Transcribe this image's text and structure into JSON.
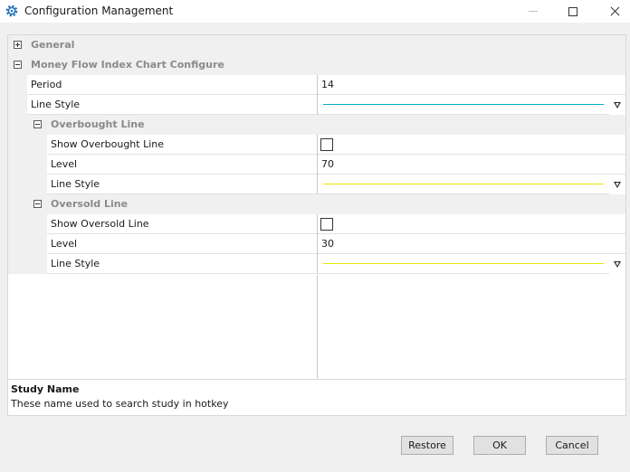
{
  "window": {
    "title": "Configuration Management",
    "icon": "gear-icon"
  },
  "grid": {
    "categories": [
      {
        "label": "General",
        "expanded": false
      },
      {
        "label": "Money Flow Index Chart Configure",
        "expanded": true
      }
    ],
    "period": {
      "name": "Period",
      "value": "14"
    },
    "line_style": {
      "name": "Line Style",
      "color": "#00b0c8"
    },
    "overbought": {
      "label": "Overbought Line",
      "show": {
        "name": "Show Overbought Line",
        "checked": false
      },
      "level": {
        "name": "Level",
        "value": "70"
      },
      "line_style": {
        "name": "Line Style",
        "color": "#e8e800"
      }
    },
    "oversold": {
      "label": "Oversold Line",
      "show": {
        "name": "Show Oversold Line",
        "checked": false
      },
      "level": {
        "name": "Level",
        "value": "30"
      },
      "line_style": {
        "name": "Line Style",
        "color": "#e8e800"
      }
    }
  },
  "description": {
    "title": "Study Name",
    "text": "These name used to search study in hotkey"
  },
  "buttons": {
    "restore": "Restore",
    "ok": "OK",
    "cancel": "Cancel"
  }
}
